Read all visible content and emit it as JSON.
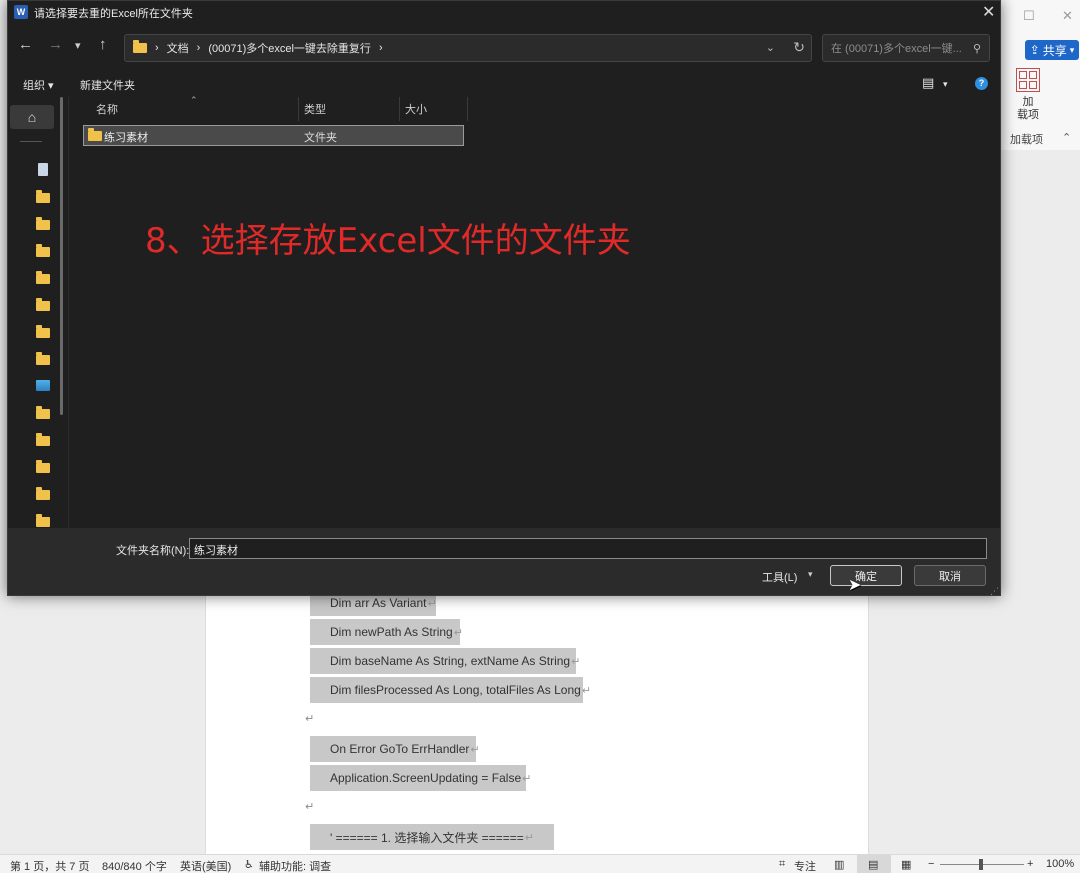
{
  "dialog": {
    "title": "请选择要去重的Excel所在文件夹",
    "app_icon_letter": "W",
    "breadcrumb": [
      "文档",
      "(00071)多个excel一键去除重复行"
    ],
    "search_placeholder": "在 (00071)多个excel一键...",
    "toolbar": {
      "organize": "组织 ▾",
      "new_folder": "新建文件夹"
    },
    "columns": {
      "name": "名称",
      "type": "类型",
      "size": "大小"
    },
    "rows": [
      {
        "name": "练习素材",
        "type": "文件夹"
      }
    ],
    "annotation": "8、选择存放Excel文件的文件夹",
    "folder_label": "文件夹名称(N):",
    "folder_value": "练习素材",
    "tools_label": "工具(L)",
    "ok_label": "确定",
    "cancel_label": "取消"
  },
  "word": {
    "share_label": "共享",
    "addin_label": "加\n载项",
    "addin_group": "加载项",
    "code_lines": [
      "Dim arr As Variant",
      "Dim newPath As String",
      "Dim baseName As String, extName As String",
      "Dim filesProcessed As Long, totalFiles As Long",
      "On Error GoTo ErrHandler",
      "Application.ScreenUpdating = False",
      "' ====== 1. 选择输入文件夹  ======"
    ],
    "para_mark": "↵",
    "status": {
      "page": "第 1 页，共 7 页",
      "words": "840/840 个字",
      "language": "英语(美国)",
      "accessibility": "辅助功能: 调查",
      "focus": "专注",
      "zoom": "100%"
    }
  }
}
